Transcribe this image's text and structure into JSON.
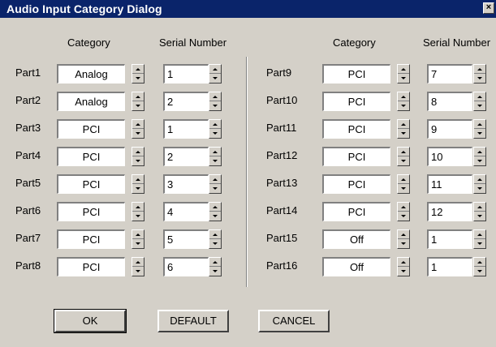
{
  "window": {
    "title": "Audio Input Category Dialog",
    "close_glyph": "×"
  },
  "headers": {
    "left_category": "Category",
    "left_serial": "Serial Number",
    "right_category": "Category",
    "right_serial": "Serial Number"
  },
  "left_parts": [
    {
      "label": "Part1",
      "category": "Analog",
      "serial": "1"
    },
    {
      "label": "Part2",
      "category": "Analog",
      "serial": "2"
    },
    {
      "label": "Part3",
      "category": "PCI",
      "serial": "1"
    },
    {
      "label": "Part4",
      "category": "PCI",
      "serial": "2"
    },
    {
      "label": "Part5",
      "category": "PCI",
      "serial": "3"
    },
    {
      "label": "Part6",
      "category": "PCI",
      "serial": "4"
    },
    {
      "label": "Part7",
      "category": "PCI",
      "serial": "5"
    },
    {
      "label": "Part8",
      "category": "PCI",
      "serial": "6"
    }
  ],
  "right_parts": [
    {
      "label": "Part9",
      "category": "PCI",
      "serial": "7"
    },
    {
      "label": "Part10",
      "category": "PCI",
      "serial": "8"
    },
    {
      "label": "Part11",
      "category": "PCI",
      "serial": "9"
    },
    {
      "label": "Part12",
      "category": "PCI",
      "serial": "10"
    },
    {
      "label": "Part13",
      "category": "PCI",
      "serial": "11"
    },
    {
      "label": "Part14",
      "category": "PCI",
      "serial": "12"
    },
    {
      "label": "Part15",
      "category": "Off",
      "serial": "1"
    },
    {
      "label": "Part16",
      "category": "Off",
      "serial": "1"
    }
  ],
  "buttons": {
    "ok": "OK",
    "default": "DEFAULT",
    "cancel": "CANCEL"
  }
}
